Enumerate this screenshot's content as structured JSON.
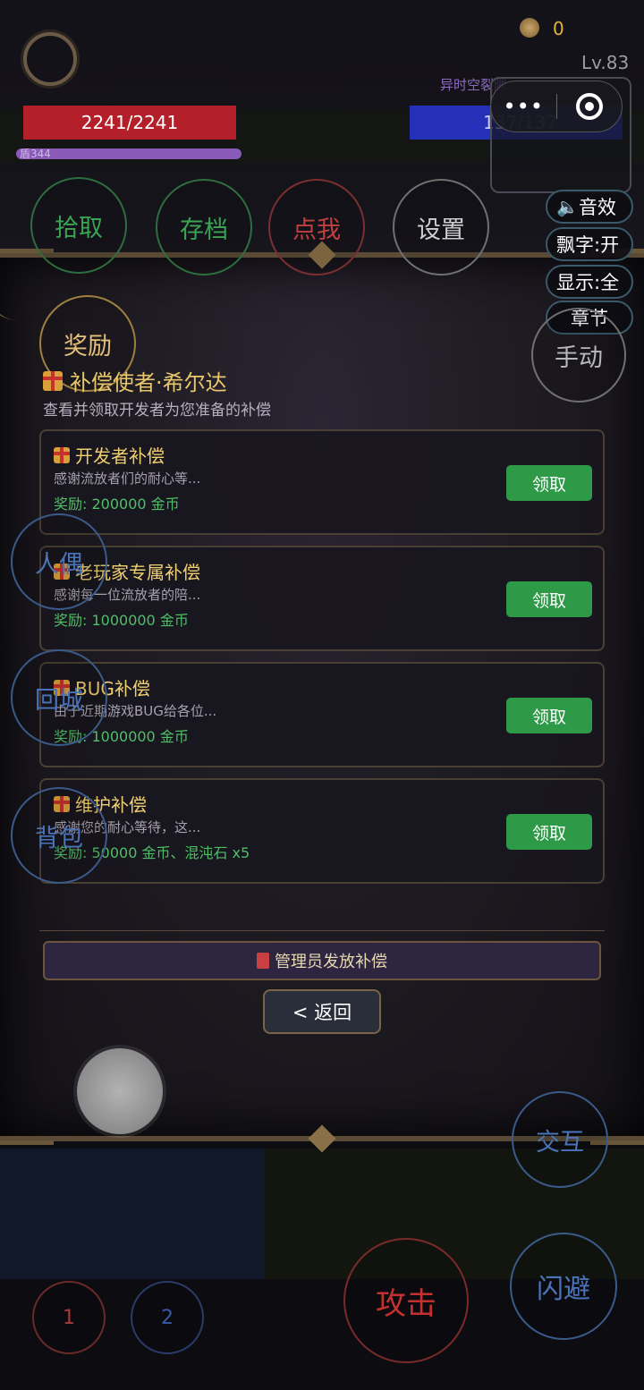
{
  "hud": {
    "gold": "0",
    "level": "Lv.83",
    "zone": "异时空裂隙",
    "hp": "2241/2241",
    "shield": "盾344",
    "mp": "137/137"
  },
  "buttons": {
    "pickup": "拾取",
    "save": "存档",
    "click_me": "点我",
    "settings": "设置",
    "reward": "奖励",
    "manual": "手动",
    "puppet": "人偶",
    "return_city": "回城",
    "backpack": "背包",
    "interact": "交互",
    "attack": "攻击",
    "dodge": "闪避",
    "skill1": "1",
    "skill2": "2"
  },
  "toggles": {
    "sound": "音效",
    "float_text": "飘字:开",
    "display": "显示:全",
    "chapter": "章节"
  },
  "dialog": {
    "title": "补偿使者·希尔达",
    "subtitle": "查看并领取开发者为您准备的补偿",
    "claim_label": "领取",
    "items": [
      {
        "title": "开发者补偿",
        "desc": "感谢流放者们的耐心等...",
        "reward": "奖励: 200000 金币"
      },
      {
        "title": "老玩家专属补偿",
        "desc": "感谢每一位流放者的陪...",
        "reward": "奖励: 1000000 金币"
      },
      {
        "title": "BUG补偿",
        "desc": "由于近期游戏BUG给各位...",
        "reward": "奖励: 1000000 金币"
      },
      {
        "title": "维护补偿",
        "desc": "感谢您的耐心等待，这...",
        "reward": "奖励: 50000 金币、混沌石 x5"
      }
    ],
    "admin_button": "管理员发放补偿",
    "back_button": "< 返回"
  },
  "colors": {
    "gold_text": "#e6b23a",
    "reward_green": "#4fbf66",
    "claim_green": "#2e9a48",
    "hp_red": "#b3202a",
    "mp_blue": "#2530b8"
  }
}
